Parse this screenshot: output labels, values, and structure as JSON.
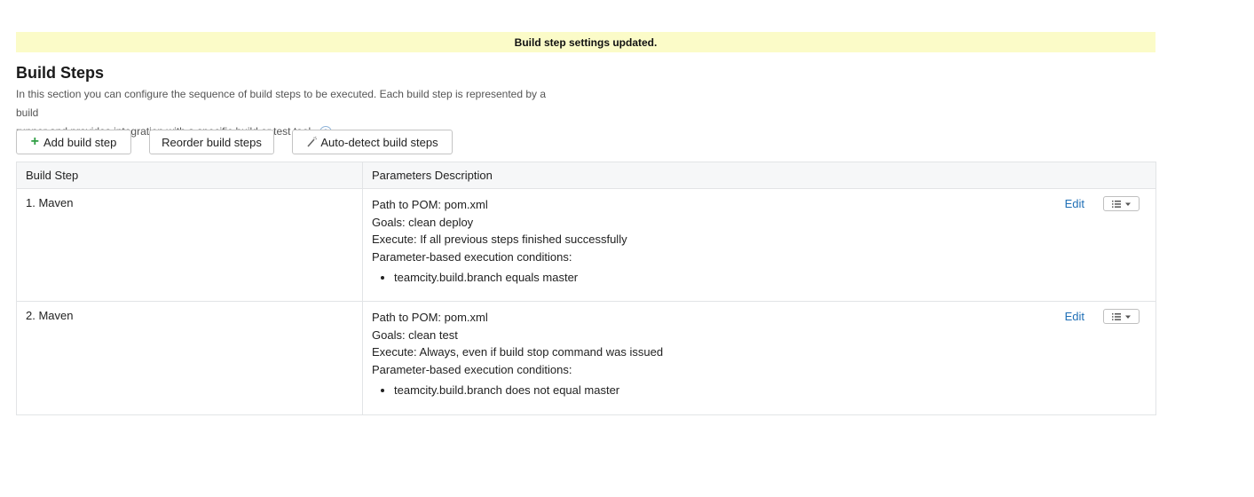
{
  "notice": {
    "text": "Build step settings updated."
  },
  "header": {
    "title": "Build Steps",
    "description_line1": "In this section you can configure the sequence of build steps to be executed. Each build step is represented by a build",
    "description_line2": "runner and provides integration with a specific build or test tool."
  },
  "toolbar": {
    "add_label": "Add build step",
    "reorder_label": "Reorder build steps",
    "autodetect_label": "Auto-detect build steps"
  },
  "table": {
    "col_step": "Build Step",
    "col_params": "Parameters Description",
    "edit_label": "Edit",
    "rows": [
      {
        "name": "1. Maven",
        "pom": "Path to POM: pom.xml",
        "goals": "Goals: clean deploy",
        "execute": "Execute: If all previous steps finished successfully",
        "conditions_label": "Parameter-based execution conditions:",
        "condition": "teamcity.build.branch equals master"
      },
      {
        "name": "2. Maven",
        "pom": "Path to POM: pom.xml",
        "goals": "Goals: clean test",
        "execute": "Execute: Always, even if build stop command was issued",
        "conditions_label": "Parameter-based execution conditions:",
        "condition": "teamcity.build.branch does not equal master"
      }
    ]
  },
  "icons": {
    "help": "help-icon",
    "plus": "plus-icon",
    "wand": "magic-wand-icon",
    "menu": "list-menu-icon",
    "caret": "caret-down-icon"
  },
  "colors": {
    "notice_bg": "#fbfbc8",
    "link": "#1f6fb6",
    "plus": "#2f9e44",
    "header_bg": "#f6f7f8",
    "border": "#e2e4e6"
  }
}
